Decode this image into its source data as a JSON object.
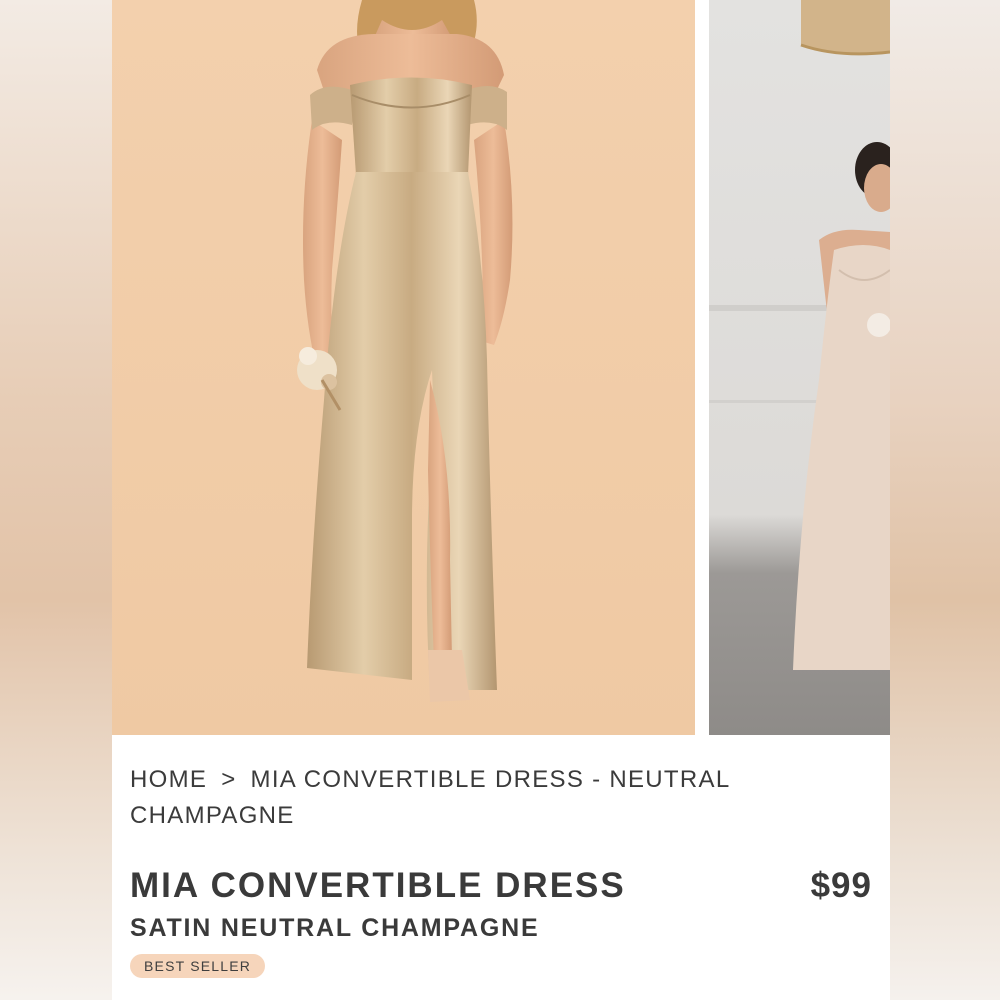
{
  "breadcrumb": {
    "home": "HOME",
    "separator": ">",
    "current": "MIA CONVERTIBLE DRESS - NEUTRAL CHAMPAGNE"
  },
  "product": {
    "title": "MIA CONVERTIBLE DRESS",
    "subtitle": "SATIN NEUTRAL CHAMPAGNE",
    "price": "$99",
    "badge": "BEST SELLER"
  },
  "colors": {
    "background_main_photo": "#f1cca7",
    "dress_champagne": "#c9ad86",
    "badge_bg": "#f6d5bb",
    "text": "#3a3a3a"
  }
}
